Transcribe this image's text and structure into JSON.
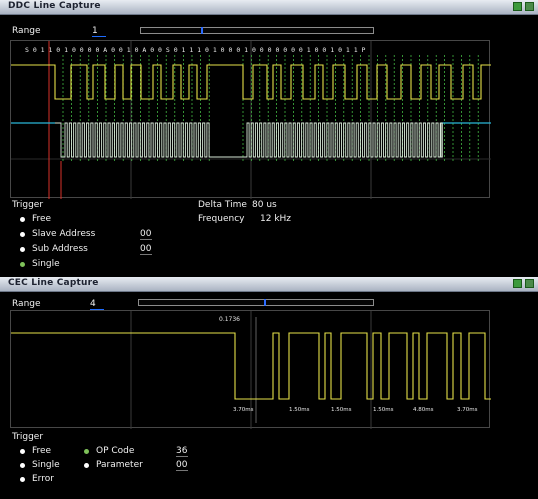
{
  "ddc": {
    "title": "DDC Line Capture",
    "range_label": "Range",
    "range_value": "1",
    "bits_label": "S  0  1 1 0 1 0 0 0 0 A 0 0 1 0 A 0 0      S  0  1 1 1 0 1 0  0 0 1 0 0 0 0 0  0 0 1 0  0 1 0  1 1      P",
    "trigger": {
      "label": "Trigger",
      "free": "Free",
      "slave_address": "Slave Address",
      "slave_address_value": "00",
      "sub_address": "Sub Address",
      "sub_address_value": "00",
      "single": "Single",
      "selected": "single"
    },
    "delta_time_label": "Delta Time",
    "delta_time_value": "80 us",
    "frequency_label": "Frequency",
    "frequency_value": "12 kHz"
  },
  "cec": {
    "title": "CEC Line Capture",
    "range_label": "Range",
    "range_value": "4",
    "top_label": "0.1736",
    "timing_labels": [
      "3.70ms",
      "1.50ms",
      "1.50ms",
      "1.50ms",
      "4.80ms",
      "3.70ms"
    ],
    "trigger": {
      "label": "Trigger",
      "free": "Free",
      "single": "Single",
      "error": "Error",
      "op_code": "OP Code",
      "op_code_value": "36",
      "parameter": "Parameter",
      "parameter_value": "00",
      "selected": "op_code"
    }
  },
  "colors": {
    "sda": "#e6e24a",
    "scl": "#d8e8d8",
    "cursor_blue": "#29b7d8",
    "cursor_red": "#d8322a",
    "dashed": "#4ccf4c",
    "accent": "#1e6cff"
  }
}
